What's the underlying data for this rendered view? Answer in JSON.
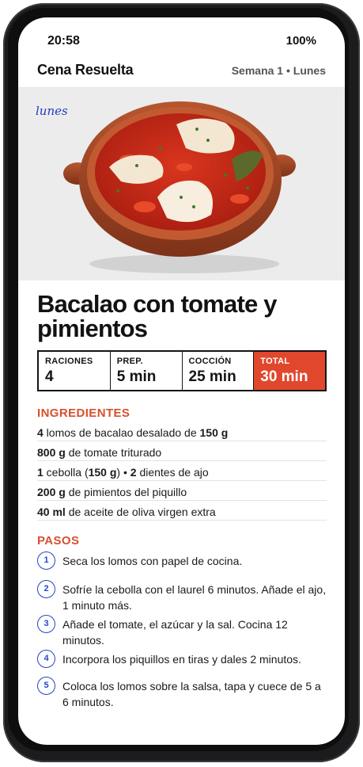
{
  "status_bar": {
    "time": "20:58",
    "battery": "100%"
  },
  "header": {
    "app_title": "Cena Resuelta",
    "week_label": "Semana 1 • Lunes"
  },
  "hero": {
    "day_tag": "lunes"
  },
  "recipe": {
    "title": "Bacalao con tomate y pimientos",
    "stats": [
      {
        "label": "RACIONES",
        "value": "4"
      },
      {
        "label": "PREP.",
        "value": "5 min"
      },
      {
        "label": "COCCIÓN",
        "value": "25 min"
      },
      {
        "label": "TOTAL",
        "value": "30 min"
      }
    ]
  },
  "ingredients": {
    "heading": "INGREDIENTES",
    "items": [
      {
        "parts": [
          {
            "b": "4"
          },
          {
            "t": " lomos de bacalao desalado de "
          },
          {
            "b": "150 g"
          }
        ]
      },
      {
        "parts": [
          {
            "b": "800 g"
          },
          {
            "t": " de tomate triturado"
          }
        ]
      },
      {
        "parts": [
          {
            "b": "1"
          },
          {
            "t": " cebolla ("
          },
          {
            "b": "150 g"
          },
          {
            "t": ") • "
          },
          {
            "b": "2"
          },
          {
            "t": " dientes de ajo"
          }
        ]
      },
      {
        "parts": [
          {
            "b": "200 g"
          },
          {
            "t": " de pimientos del piquillo"
          }
        ]
      },
      {
        "parts": [
          {
            "b": "40 ml"
          },
          {
            "t": " de aceite de oliva virgen extra"
          }
        ]
      }
    ]
  },
  "steps": {
    "heading": "PASOS",
    "items": [
      {
        "num": "1",
        "text": "Seca los lomos con papel de cocina."
      },
      {
        "num": "2",
        "text": "Sofríe la cebolla con el laurel 6 minutos. Añade el ajo, 1 minuto más."
      },
      {
        "num": "3",
        "text": "Añade el tomate, el azúcar y la sal. Cocina 12 minutos."
      },
      {
        "num": "4",
        "text": "Incorpora los piquillos en tiras y dales 2 minutos."
      },
      {
        "num": "5",
        "text": "Coloca los lomos sobre la salsa, tapa y cuece de 5 a 6 minutos."
      }
    ]
  },
  "colors": {
    "accent": "#e0472d",
    "step_blue": "#2545c8",
    "dish": "#a4482a"
  }
}
